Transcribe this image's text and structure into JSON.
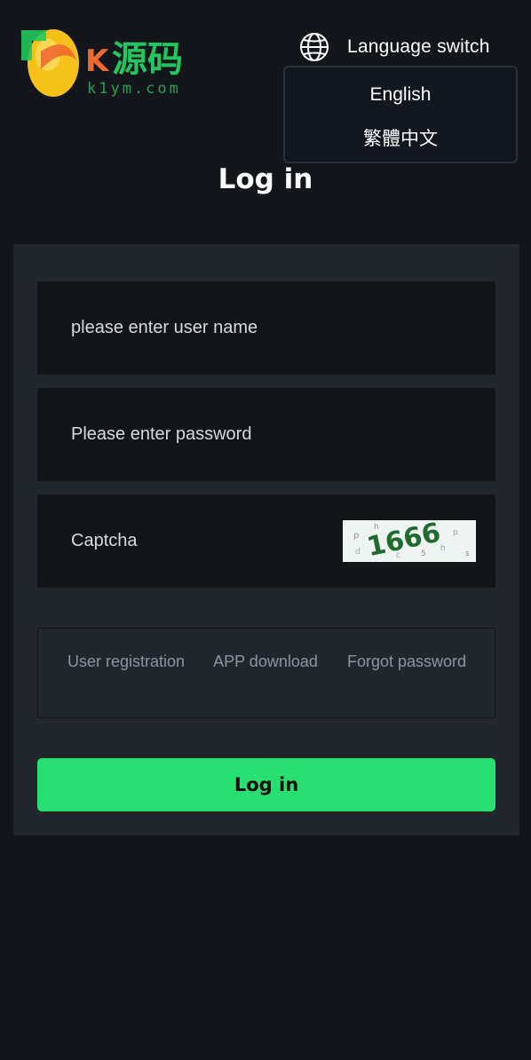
{
  "logo": {
    "main_text": "源码",
    "sub_text": "k1ym.com"
  },
  "header": {
    "language_switch_label": "Language switch"
  },
  "language_menu": {
    "options": [
      "English",
      "繁體中文"
    ]
  },
  "page": {
    "title": "Log in"
  },
  "form": {
    "username_placeholder": "please enter user name",
    "password_placeholder": "Please enter password",
    "captcha_placeholder": "Captcha",
    "captcha_code": "1666"
  },
  "links": {
    "register": "User registration",
    "app_download": "APP download",
    "forgot_password": "Forgot password"
  },
  "actions": {
    "login_label": "Log in"
  },
  "colors": {
    "background": "#13171b",
    "panel": "#22272d",
    "field": "#131619",
    "accent": "#28e06f",
    "link": "#8d94a0"
  }
}
